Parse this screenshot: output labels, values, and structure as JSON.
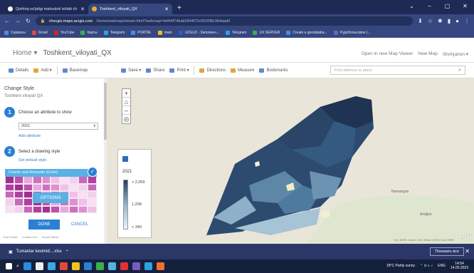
{
  "browser": {
    "tabs": [
      {
        "label": "Qishloq xo'jaligi mahsuloti ishlab ch",
        "active": false,
        "favicon_color": "#ffffff"
      },
      {
        "label": "Toshkent_viloyati_QX",
        "active": true,
        "favicon_color": "#f0a830"
      }
    ],
    "new_tab_icon": "plus-icon",
    "window_controls": [
      "chevron-down-icon",
      "minimize-icon",
      "restore-icon",
      "close-icon"
    ],
    "url_host": "chocgis.maps.arcgis.com",
    "url_path": "/home/webmap/viewer.html?webmap=4efb4f74bab0944f72c5620f8c3b4aad0",
    "bookmarks": [
      {
        "label": "Сервисы",
        "color": "#4a8ce0"
      },
      {
        "label": "Gmail",
        "color": "#e04a3c"
      },
      {
        "label": "YouTube",
        "color": "#e02020"
      },
      {
        "label": "Карты",
        "color": "#3cb04a"
      },
      {
        "label": "Telegram",
        "color": "#2aa3e0"
      },
      {
        "label": "PORTAL",
        "color": "#4a8ce0"
      },
      {
        "label": "main",
        "color": "#e0c020"
      },
      {
        "label": "UZGUZ - Заполнен...",
        "color": "#2a60c0"
      },
      {
        "label": "Telegram",
        "color": "#2aa3e0"
      },
      {
        "label": "UX SERVER",
        "color": "#3cb04a"
      },
      {
        "label": "Create a geodataba...",
        "color": "#4a8ce0"
      },
      {
        "label": "Рудобольсовое (...",
        "color": "#7a5ac0"
      }
    ]
  },
  "app": {
    "home": "Home ▾",
    "map_title": "Toshkent_viloyati_QX",
    "links": [
      "Open in new Map Viewer",
      "New Map",
      "Shohjahon ▾"
    ]
  },
  "toolbar": {
    "details": "Details",
    "add": "Add ▾",
    "basemap": "Basemap",
    "save": "Save ▾",
    "share": "Share",
    "print": "Print ▾",
    "directions": "Directions",
    "measure": "Measure",
    "bookmarks": "Bookmarks",
    "find_placeholder": "Find address or place"
  },
  "panel": {
    "title": "Change Style",
    "layer": "Toshkent viloyati QX",
    "step1_num": "1",
    "step1_label": "Choose an attribute to show",
    "attribute_value": "2021",
    "add_attribute": "Add attribute",
    "step2_num": "2",
    "step2_label": "Select a drawing style",
    "set_default": "Set default style",
    "style_name": "Counts and Amounts (Color)",
    "options": "OPTIONS",
    "done": "DONE",
    "cancel": "CANCEL",
    "footer": [
      "Trial Center",
      "Contact Esri",
      "Report abuse"
    ]
  },
  "ramp_colors": [
    "#c050a8",
    "#e090d0",
    "#f4d0ec",
    "#a03090",
    "#d070c0",
    "#f8e0f4",
    "#b040a0",
    "#e8a8dc",
    "#f0c0e8",
    "#c868b8"
  ],
  "legend": {
    "year": "2021",
    "values": [
      "> 2,069",
      "1,208",
      "< 349"
    ],
    "ramp": [
      "#253b5e",
      "#8fb6cf",
      "#edf4f9"
    ]
  },
  "map": {
    "attribution": "Esri, HERE, Garmin, FAO, NOAA, USGS | Esri, HERE",
    "esri": "esri",
    "place_labels": [
      "Namangan",
      "Andijon"
    ]
  },
  "download": {
    "file": "Tumanlar kesimid....xlsx",
    "show_all": "Показать все"
  },
  "taskbar": {
    "weather": "18°C  Partly sunny",
    "lang": "ENG",
    "time": "14:54",
    "date": "14.05.2023"
  }
}
